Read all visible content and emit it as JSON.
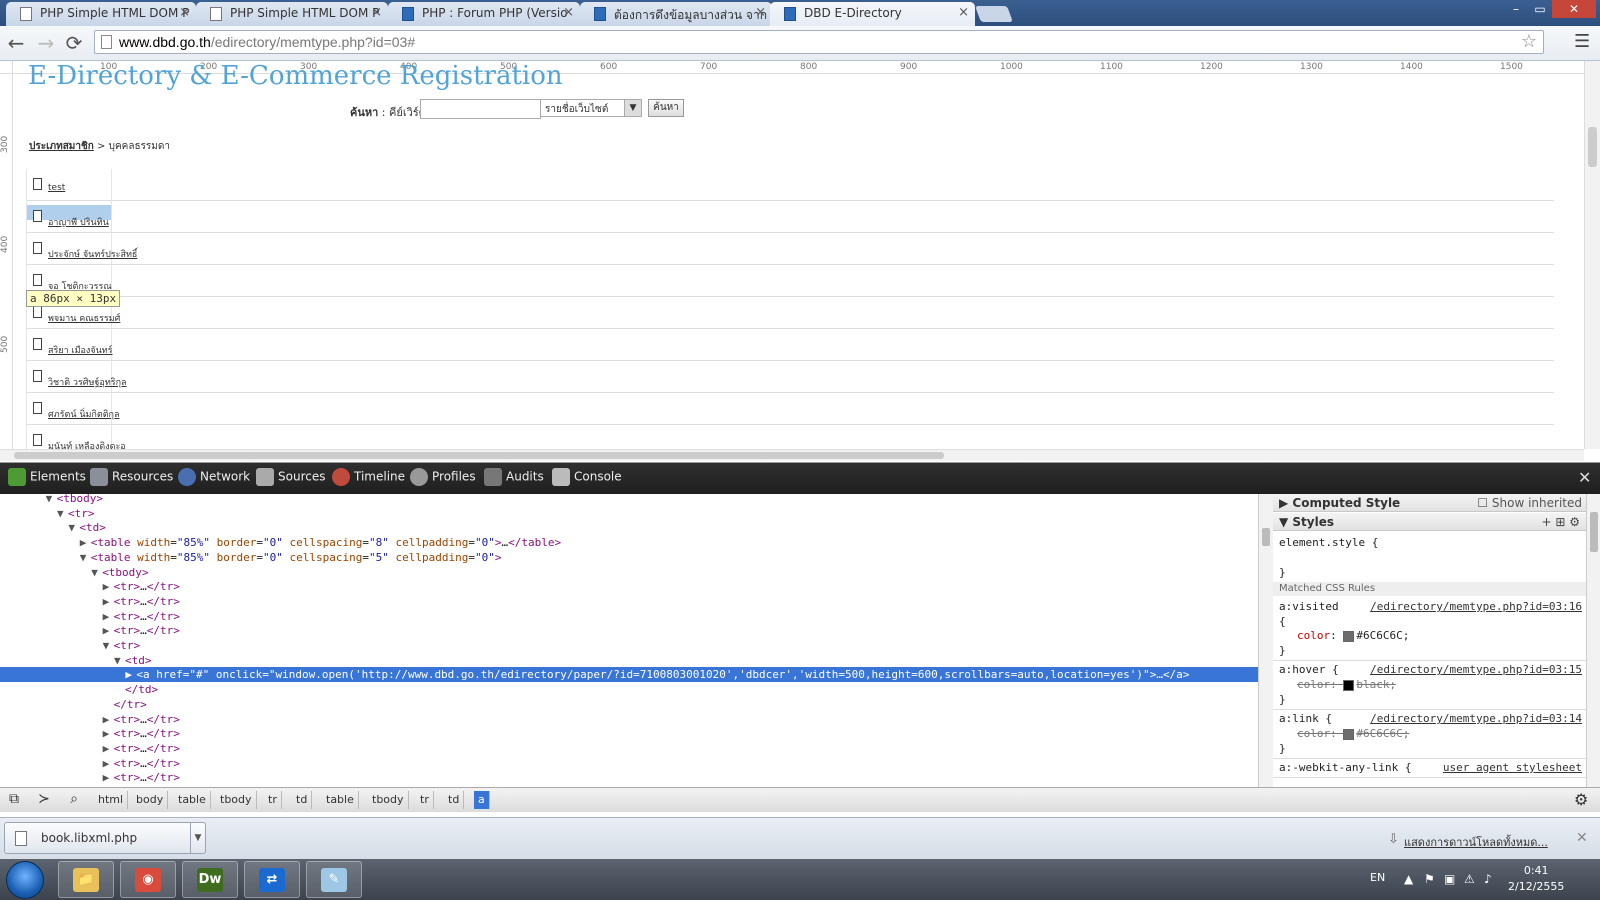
{
  "browser": {
    "tabs": [
      {
        "title": "PHP Simple HTML DOM P",
        "active": false
      },
      {
        "title": "PHP Simple HTML DOM P",
        "active": false
      },
      {
        "title": "PHP : Forum PHP (Versio",
        "active": false
      },
      {
        "title": "ต้องการดึงข้อมูลบางส่วน จาก",
        "active": false
      },
      {
        "title": "DBD E-Directory",
        "active": true
      }
    ],
    "close_glyph": "×",
    "window_controls": {
      "minimize": "–",
      "maximize": "▭",
      "close": "✕"
    },
    "nav": {
      "back": "←",
      "forward": "→",
      "reload": "⟳",
      "menu": "☰",
      "star": "☆"
    },
    "url": {
      "host": "www.dbd.go.th",
      "path": "/edirectory/memtype.php?id=03#"
    }
  },
  "page": {
    "title": "E-Directory & E-Commerce Registration",
    "ruler_top": [
      "100",
      "200",
      "300",
      "400",
      "500",
      "600",
      "700",
      "800",
      "900",
      "1000",
      "1100",
      "1200",
      "1300",
      "1400",
      "1500"
    ],
    "ruler_left": [
      "300",
      "400",
      "500"
    ],
    "search": {
      "label_bold": "ค้นหา",
      "label_rest": " : คีย์เวิร์ด",
      "input_value": "",
      "select_value": "รายชื่อเว็บไซต์",
      "button_label": "ค้นหา"
    },
    "breadcrumb": {
      "link": "ประเภทสมาชิก",
      "separator": " > ",
      "current": "บุคคลธรรมดา"
    },
    "members": [
      "test",
      "อาญาพี ปรินทิน",
      "ประจักษ์ จันทร์ประสิทธิ์",
      "จอ โชติกะวรรณ",
      "พจมาน คณธรรมศ์",
      "สริยา เมืองจันทร์",
      "วิชาติ วรศิษฐ์อุทริกุล",
      "ศภรัตน์ นิ่มกิตติกุล",
      "มนันท์ เหลืองดิงดะอุ"
    ],
    "inspect_tooltip": {
      "tag": "a",
      "size": "86px × 13px"
    }
  },
  "devtools": {
    "tabs": [
      "Elements",
      "Resources",
      "Network",
      "Sources",
      "Timeline",
      "Profiles",
      "Audits",
      "Console"
    ],
    "close": "✕",
    "dom_lines": [
      {
        "indent": 4,
        "tri": "▼",
        "html": "<tbody>"
      },
      {
        "indent": 5,
        "tri": "▼",
        "html": "<tr>"
      },
      {
        "indent": 6,
        "tri": "▼",
        "html": "<td>"
      },
      {
        "indent": 7,
        "tri": "▶",
        "html": "<table width=\"85%\" border=\"0\" cellspacing=\"8\" cellpadding=\"0\">…</table>"
      },
      {
        "indent": 7,
        "tri": "▼",
        "html": "<table width=\"85%\" border=\"0\" cellspacing=\"5\" cellpadding=\"0\">"
      },
      {
        "indent": 8,
        "tri": "▼",
        "html": "<tbody>"
      },
      {
        "indent": 9,
        "tri": "▶",
        "html": "<tr>…</tr>"
      },
      {
        "indent": 9,
        "tri": "▶",
        "html": "<tr>…</tr>"
      },
      {
        "indent": 9,
        "tri": "▶",
        "html": "<tr>…</tr>"
      },
      {
        "indent": 9,
        "tri": "▶",
        "html": "<tr>…</tr>"
      },
      {
        "indent": 9,
        "tri": "▼",
        "html": "<tr>"
      },
      {
        "indent": 10,
        "tri": "▼",
        "html": "<td>"
      },
      {
        "indent": 11,
        "tri": "▶",
        "html": "<a href=\"#\" onclick=\"window.open('http://www.dbd.go.th/edirectory/paper/?id=7100803001020','dbdcer','width=500,height=600,scrollbars=auto,location=yes')\">…</a>",
        "selected": true
      },
      {
        "indent": 10,
        "tri": "",
        "html": "</td>"
      },
      {
        "indent": 9,
        "tri": "",
        "html": "</tr>"
      },
      {
        "indent": 9,
        "tri": "▶",
        "html": "<tr>…</tr>"
      },
      {
        "indent": 9,
        "tri": "▶",
        "html": "<tr>…</tr>"
      },
      {
        "indent": 9,
        "tri": "▶",
        "html": "<tr>…</tr>"
      },
      {
        "indent": 9,
        "tri": "▶",
        "html": "<tr>…</tr>"
      },
      {
        "indent": 9,
        "tri": "▶",
        "html": "<tr>…</tr>"
      }
    ],
    "styles": {
      "computed_header": "Computed Style",
      "show_inherited": "Show inherited",
      "styles_header": "Styles",
      "tools": "+  ⊞  ⚙",
      "element_style_open": "element.style {",
      "element_style_close": "}",
      "matched_header": "Matched CSS Rules",
      "rules": [
        {
          "selector": "a:visited",
          "source": "/edirectory/memtype.php?id=03:16",
          "open": "{",
          "prop": "color",
          "value": "#6C6C6C;",
          "swatch": "#6C6C6C",
          "struck": false,
          "close": "}"
        },
        {
          "selector": "a:hover {",
          "source": "/edirectory/memtype.php?id=03:15",
          "open": "",
          "prop": "color",
          "value": "black;",
          "swatch": "#000000",
          "struck": true,
          "close": "}"
        },
        {
          "selector": "a:link {",
          "source": "/edirectory/memtype.php?id=03:14",
          "open": "",
          "prop": "color",
          "value": "#6C6C6C;",
          "swatch": "#6C6C6C",
          "struck": true,
          "close": "}"
        },
        {
          "selector": "a:-webkit-any-link {",
          "source": "user agent stylesheet",
          "open": "",
          "prop": "",
          "value": "",
          "swatch": "",
          "struck": false,
          "close": ""
        }
      ]
    },
    "breadcrumbs": [
      "html",
      "body",
      "table",
      "tbody",
      "tr",
      "td",
      "table",
      "tbody",
      "tr",
      "td",
      "a"
    ],
    "status_icons": [
      "dock-icon",
      "console-drawer-icon",
      "search-icon"
    ],
    "gear": "⚙"
  },
  "downloads": {
    "file": "book.libxml.php",
    "show_all": "แสดงการดาวน์โหลดทั้งหมด...",
    "close": "✕"
  },
  "taskbar": {
    "apps": [
      {
        "name": "explorer",
        "label": "📁",
        "color": "#e8c15a"
      },
      {
        "name": "chrome",
        "label": "◉",
        "color": "#d94b3c"
      },
      {
        "name": "dreamweaver",
        "label": "Dw",
        "color": "#3e6d1f"
      },
      {
        "name": "teamviewer",
        "label": "⇄",
        "color": "#1b6ad1"
      },
      {
        "name": "notepad",
        "label": "✎",
        "color": "#9ec7e6"
      }
    ],
    "lang": "EN",
    "time": "0:41",
    "date": "2/12/2555"
  },
  "colors": {
    "site_title": "#53a4d6",
    "selection": "#3875d7",
    "devtools_toolbar": "#262626"
  }
}
